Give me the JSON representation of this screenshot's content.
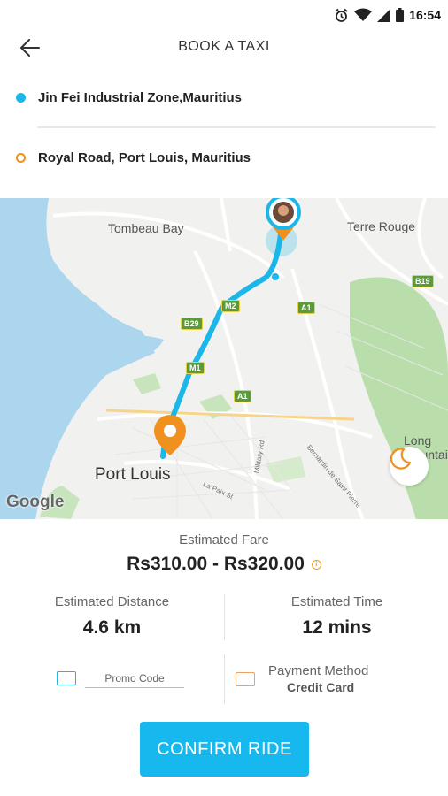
{
  "status_bar": {
    "time": "16:54",
    "icons": [
      "alarm-icon",
      "wifi-icon",
      "signal-icon",
      "battery-icon"
    ]
  },
  "header": {
    "title": "BOOK A TAXI",
    "back_icon": "arrow-left-icon"
  },
  "pickup": {
    "address": "Jin Fei Industrial Zone,Mauritius",
    "dot_color": "#1ab7e8"
  },
  "dropoff": {
    "address": "Royal Road, Port Louis, Mauritius",
    "dot_color": "#f0901e"
  },
  "map": {
    "labels": {
      "tombeau_bay": "Tombeau Bay",
      "terre_rouge": "Terre Rouge",
      "port_louis": "Port Louis",
      "long_mountain": "Long\nMountain"
    },
    "street_labels": {
      "military_rd": "Military Rd",
      "la_paix_st": "La Paix St",
      "bernardin": "Bernardin de Saint Pierre"
    },
    "road_badges": {
      "m2": "M2",
      "m1": "M1",
      "a1_top": "A1",
      "a1_mid": "A1",
      "b29": "B29",
      "b19": "B19"
    },
    "google_logo": "Google",
    "route_color": "#1ab7e8",
    "night_mode_icon": "moon-icon"
  },
  "fare": {
    "label": "Estimated Fare",
    "value": "Rs310.00 - Rs320.00",
    "info_icon": "info-icon"
  },
  "distance": {
    "label": "Estimated Distance",
    "value": "4.6 km"
  },
  "time": {
    "label": "Estimated Time",
    "value": "12 mins"
  },
  "promo": {
    "label": "Promo Code",
    "icon": "ticket-icon"
  },
  "payment": {
    "label": "Payment Method",
    "value": "Credit Card",
    "icon": "card-icon"
  },
  "confirm": {
    "label": "CONFIRM RIDE",
    "color": "#17b8ee"
  }
}
